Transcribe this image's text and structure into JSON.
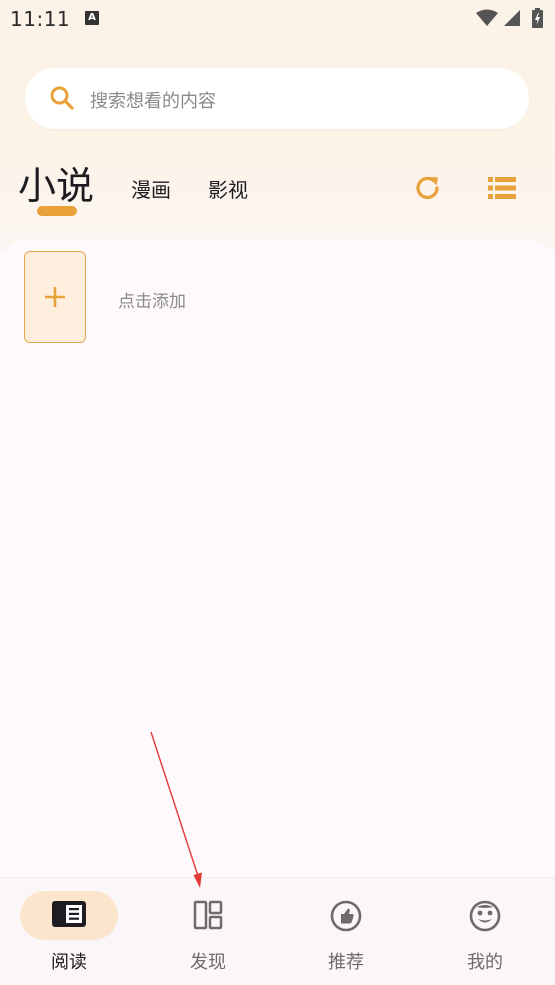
{
  "status_bar": {
    "time": "11:11",
    "notification_icon": "A"
  },
  "search": {
    "placeholder": "搜索想看的内容"
  },
  "tabs": {
    "active": "小说",
    "comic": "漫画",
    "video": "影视"
  },
  "shelf": {
    "add_label": "点击添加"
  },
  "bottom_nav": {
    "items": [
      {
        "label": "阅读",
        "icon": "book-icon",
        "active": true
      },
      {
        "label": "发现",
        "icon": "dashboard-icon",
        "active": false
      },
      {
        "label": "推荐",
        "icon": "thumb-up-icon",
        "active": false
      },
      {
        "label": "我的",
        "icon": "face-icon",
        "active": false
      }
    ]
  },
  "colors": {
    "accent": "#e9a13a",
    "annotation": "#e53935"
  }
}
